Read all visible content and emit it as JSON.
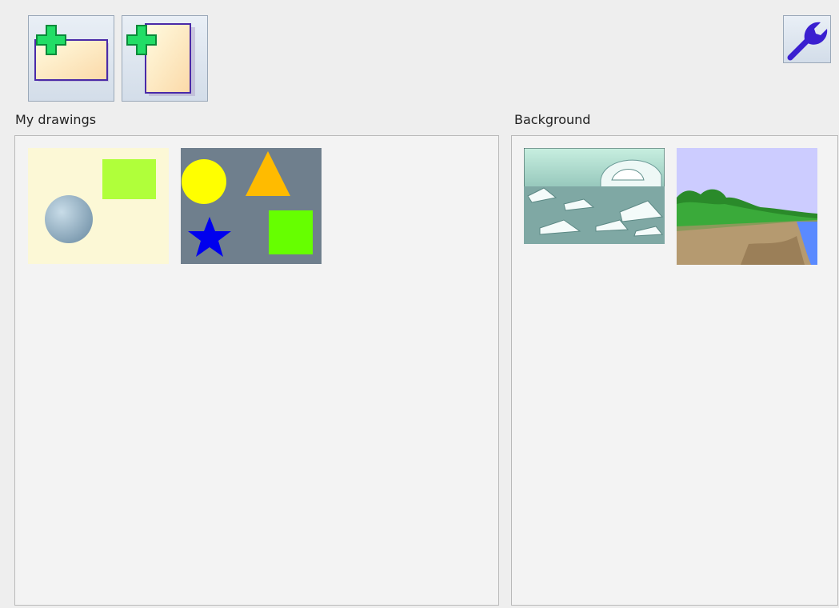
{
  "toolbar": {
    "new_landscape_icon": "new-landscape-page-icon",
    "new_portrait_icon": "new-portrait-page-icon",
    "settings_icon": "wrench-icon"
  },
  "sections": {
    "drawings_label": "My drawings",
    "background_label": "Background"
  },
  "colors": {
    "plus_green": "#22dd66",
    "page_border": "#4a2aa8",
    "wrench_blue": "#3a1fd0",
    "drawing1_bg": "#fcf8d6",
    "drawing2_bg": "#6f7f8d"
  },
  "drawings": [
    {
      "name": "drawing-shapes-light"
    },
    {
      "name": "drawing-shapes-dark"
    }
  ],
  "backgrounds": [
    {
      "name": "arctic-igloo"
    },
    {
      "name": "beach-coast"
    }
  ]
}
